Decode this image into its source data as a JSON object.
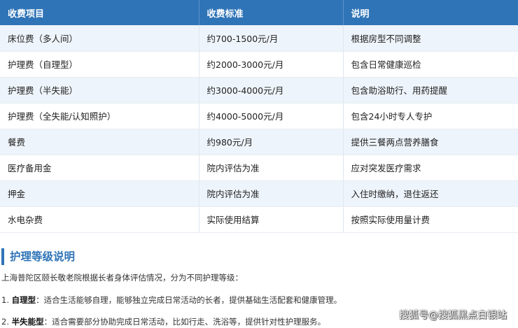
{
  "fee_table": {
    "headers": [
      "收费项目",
      "收费标准",
      "说明"
    ],
    "rows": [
      [
        "床位费（多人间）",
        "约700-1500元/月",
        "根据房型不同调整"
      ],
      [
        "护理费（自理型）",
        "约2000-3000元/月",
        "包含日常健康巡检"
      ],
      [
        "护理费（半失能）",
        "约3000-4000元/月",
        "包含助浴助行、用药提醒"
      ],
      [
        "护理费（全失能/认知照护）",
        "约4000-5000元/月",
        "包含24小时专人专护"
      ],
      [
        "餐费",
        "约980元/月",
        "提供三餐两点营养膳食"
      ],
      [
        "医疗备用金",
        "院内评估为准",
        "应对突发医疗需求"
      ],
      [
        "押金",
        "院内评估为准",
        "入住时缴纳，退住返还"
      ],
      [
        "水电杂费",
        "实际使用结算",
        "按照实际使用量计费"
      ]
    ]
  },
  "section": {
    "title": "护理等级说明",
    "intro": "上海普陀区颐长敬老院根据长者身体评估情况，分为不同护理等级：",
    "levels": [
      {
        "prefix": "1. ",
        "name": "自理型",
        "desc": "：适合生活能够自理，能够独立完成日常活动的长者，提供基础生活配套和健康管理。"
      },
      {
        "prefix": "2. ",
        "name": "半失能型",
        "desc": "：适合需要部分协助完成日常活动，比如行走、洗浴等，提供针对性护理服务。"
      }
    ]
  },
  "watermark": "搜狐号@搜狐黑点白银站",
  "colors": {
    "header_bg": "#2f74b7",
    "accent": "#2f74b7",
    "row_alt": "#eef4fb"
  }
}
